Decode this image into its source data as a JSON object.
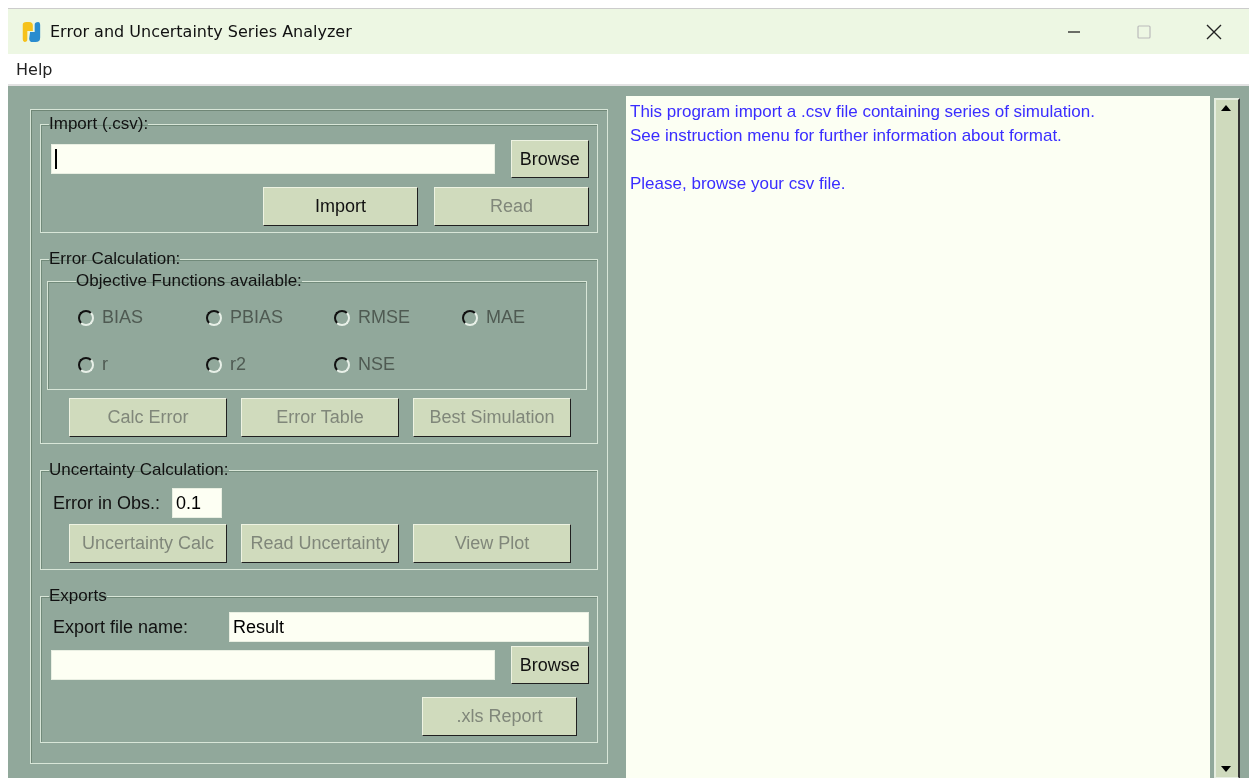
{
  "window": {
    "title": "Error and Uncertainty Series Analyzer"
  },
  "menu": [
    "Help"
  ],
  "import_group": {
    "legend": "Import (.csv):",
    "browse": {
      "label": "Browse",
      "disabled": false
    },
    "buttons": [
      {
        "label": "Import",
        "disabled": false
      },
      {
        "label": "Read",
        "disabled": true
      }
    ]
  },
  "error_group": {
    "legend": "Error Calculation:",
    "objectives_legend": "Objective Functions available:",
    "objectives": [
      {
        "label": "BIAS",
        "checked": false,
        "disabled": true
      },
      {
        "label": "PBIAS",
        "checked": false,
        "disabled": true
      },
      {
        "label": "RMSE",
        "checked": false,
        "disabled": true
      },
      {
        "label": "MAE",
        "checked": false,
        "disabled": true
      },
      {
        "label": "r",
        "checked": false,
        "disabled": true
      },
      {
        "label": "r2",
        "checked": false,
        "disabled": true
      },
      {
        "label": "NSE",
        "checked": false,
        "disabled": true
      }
    ],
    "buttons": [
      {
        "label": "Calc Error",
        "disabled": true
      },
      {
        "label": "Error Table",
        "disabled": true
      },
      {
        "label": "Best Simulation",
        "disabled": true
      }
    ]
  },
  "uncertainty_group": {
    "legend": "Uncertainty Calculation:",
    "obs_label": "Error in Obs.:",
    "obs_value": "0.1",
    "buttons": [
      {
        "label": "Uncertainty Calc",
        "disabled": true
      },
      {
        "label": "Read Uncertainty",
        "disabled": true
      },
      {
        "label": "View Plot",
        "disabled": true
      }
    ]
  },
  "exports_group": {
    "legend": "Exports",
    "name_label": "Export file name:",
    "name_value": "Result",
    "browse": {
      "label": "Browse",
      "disabled": false
    },
    "report": {
      "label": ".xls Report",
      "disabled": true
    }
  },
  "output_paragraphs": [
    [
      "This program import a .csv file containing series of simulation.",
      "See instruction menu for further information about format."
    ],
    [
      "Please, browse your csv file."
    ]
  ]
}
